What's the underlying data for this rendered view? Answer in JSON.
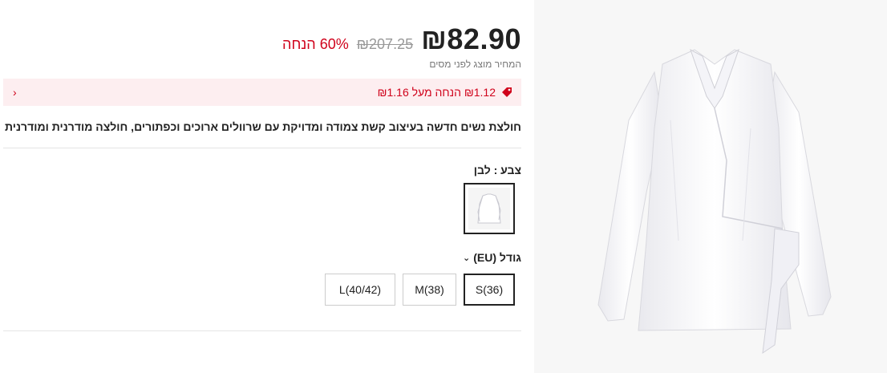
{
  "price": {
    "current": "₪82.90",
    "original": "₪207.25",
    "discount": "60% הנחה",
    "tax_note": "המחיר מוצג לפני מסים"
  },
  "promo": {
    "text": "₪1.12 הנחה מעל ₪1.16",
    "arrow": "‹",
    "accent_color": "#d0021b"
  },
  "product": {
    "title": "חולצת נשים חדשה בעיצוב קשת צמודה ומדויקת עם שרוולים ארוכים וכפתורים, חולצה מודרנית ומודרנית"
  },
  "color": {
    "label": "צבע : לבן"
  },
  "size": {
    "label": "גודל (EU)",
    "chevron": "⌄",
    "options": [
      "S(36)",
      "M(38)",
      "L(40/42)"
    ],
    "selected": "S(36)"
  },
  "icons": {
    "promo": "price-tag-icon",
    "size": "chevron-down-icon"
  }
}
